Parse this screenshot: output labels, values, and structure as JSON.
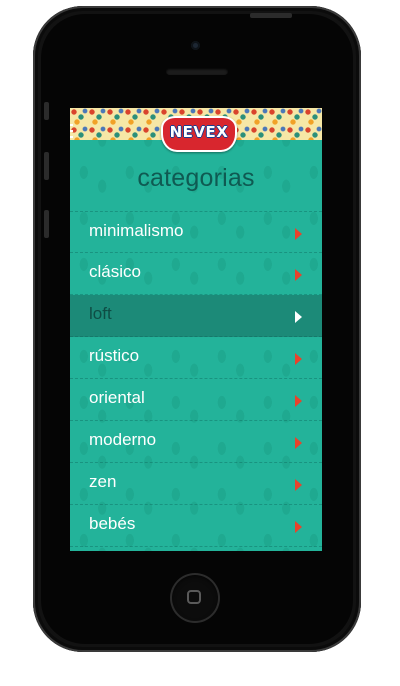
{
  "header": {
    "logo_text": "NEVEX",
    "title": "categorias"
  },
  "categories": [
    {
      "label": "minimalismo",
      "active": false
    },
    {
      "label": "clásico",
      "active": false
    },
    {
      "label": "loft",
      "active": true
    },
    {
      "label": "rústico",
      "active": false
    },
    {
      "label": "oriental",
      "active": false
    },
    {
      "label": "moderno",
      "active": false
    },
    {
      "label": "zen",
      "active": false
    },
    {
      "label": "bebés",
      "active": false
    }
  ],
  "colors": {
    "background": "#23b39a",
    "active_row": "#1c8a78",
    "title": "#0f5a52",
    "arrow": "#e8432c",
    "logo": "#d8262e"
  },
  "icons": {
    "row_arrow": "chevron-right-icon",
    "menu": "menu-icon"
  }
}
